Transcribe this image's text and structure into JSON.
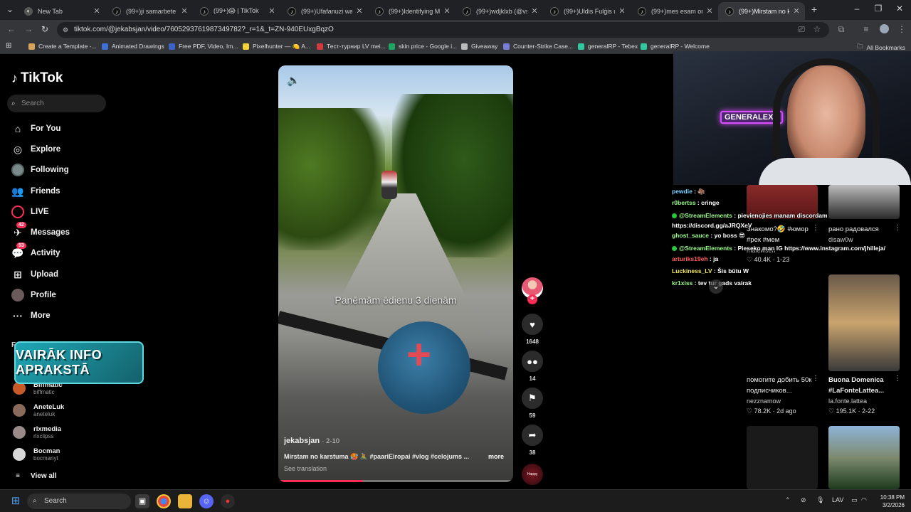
{
  "browser": {
    "tabs": [
      {
        "title": "New Tab",
        "active": false
      },
      {
        "title": "(99+)ji samarbete me",
        "active": false
      },
      {
        "title": "(99+)😱 | TikTok",
        "active": false
      },
      {
        "title": "(99+)Ufafanuzi wa Pe",
        "active": false
      },
      {
        "title": "(99+)Identifying Mys",
        "active": false
      },
      {
        "title": "(99+)wdjklxb (@vsdg",
        "active": false
      },
      {
        "title": "(99+)Uldis Fulģis un",
        "active": false
      },
      {
        "title": "(99+)mes esam origo",
        "active": false
      },
      {
        "title": "(99+)Mirstam no kars",
        "active": true
      }
    ],
    "new_tab": "+",
    "url": "tiktok.com/@jekabsjan/video/7605293761987349782?_r=1&_t=ZN-940EUxgBqzO",
    "bookmarks": [
      {
        "label": "Create a Template -...",
        "color": "#d9a35a"
      },
      {
        "label": "Animated Drawings",
        "color": "#3d6fd6"
      },
      {
        "label": "Free PDF, Video, Im...",
        "color": "#3a62c7"
      },
      {
        "label": "Pixelhunter — 🍋 A...",
        "color": "#f3d23a"
      },
      {
        "label": "Тест-турнир LV mei...",
        "color": "#d13b3b"
      },
      {
        "label": "skin price - Google i...",
        "color": "#1fa463"
      },
      {
        "label": "Giveaway",
        "color": "#bbbbbb"
      },
      {
        "label": "Counter-Strike Case...",
        "color": "#7a7fd6"
      },
      {
        "label": "generalRP - Tebex",
        "color": "#33c7a0"
      },
      {
        "label": "generalRP - Welcome",
        "color": "#33c7a0"
      }
    ],
    "all_bookmarks": "All Bookmarks"
  },
  "sidebar": {
    "logo": "TikTok",
    "search_placeholder": "Search",
    "nav": [
      {
        "label": "For You",
        "icon": "home-icon",
        "glyph": "⌂"
      },
      {
        "label": "Explore",
        "icon": "compass-icon",
        "glyph": "◎"
      },
      {
        "label": "Following",
        "icon": "following-avatar",
        "glyph": ""
      },
      {
        "label": "Friends",
        "icon": "friends-icon",
        "glyph": "👥"
      },
      {
        "label": "LIVE",
        "icon": "live-icon",
        "glyph": "◯"
      },
      {
        "label": "Messages",
        "icon": "messages-icon",
        "glyph": "✈",
        "badge": "42"
      },
      {
        "label": "Activity",
        "icon": "activity-icon",
        "glyph": "💬",
        "badge": "53"
      },
      {
        "label": "Upload",
        "icon": "upload-icon",
        "glyph": "⊞"
      },
      {
        "label": "Profile",
        "icon": "profile-avatar",
        "glyph": ""
      },
      {
        "label": "More",
        "icon": "more-icon",
        "glyph": "···"
      }
    ],
    "following_header": "F",
    "banner": "VAIRĀK INFO APRAKSTĀ",
    "following_accounts": [
      {
        "name": "Biffmatic",
        "handle": "biffmatic",
        "color": "#c85a2a"
      },
      {
        "name": "AneteLuk",
        "handle": "aneteluk",
        "color": "#8a6a5a"
      },
      {
        "name": "rlxmedia",
        "handle": "rlxclipss",
        "color": "#9a8a8a"
      },
      {
        "name": "Bocman",
        "handle": "bocmanyt",
        "color": "#d8d8d8"
      }
    ],
    "view_all": "View all"
  },
  "video": {
    "overlay_caption": "Panēmām ēdienu 3 dienām",
    "author": "jekabsjan",
    "date": "· 2-10",
    "description": "Mirstam no karstuma 🥵 🚴 #paariEiropai #vlog #celojums ...",
    "more": "more",
    "see_translation": "See translation",
    "progress": 0.36,
    "likes": "1648",
    "comments": "14",
    "saves": "59",
    "shares": "38",
    "disc_label": "Happy"
  },
  "stream": {
    "webcam_sign": "GENERALEXE",
    "chat": [
      {
        "badge": "",
        "user": "pewdie",
        "ucls": "",
        "text": " : 🦣"
      },
      {
        "badge": "",
        "user": "r0bertss",
        "ucls": "g",
        "text": " : cringe"
      },
      {
        "badge": "dot",
        "user": "@StreamElements",
        "ucls": "g",
        "text": " : pievienojies manam discordam https://discord.gg/aJRQXeV"
      },
      {
        "badge": "",
        "user": "ghost_sauce",
        "ucls": "g",
        "text": " : yo boss 😎"
      },
      {
        "badge": "dot",
        "user": "@StreamElements",
        "ucls": "g",
        "text": " : Pieseko man IG https://www.instagram.com/jhilleja/"
      },
      {
        "badge": "",
        "user": "arturiks19eh",
        "ucls": "r",
        "text": " : ja"
      },
      {
        "badge": "",
        "user": "Luckiness_LV",
        "ucls": "y",
        "text": " : Šis būtu  W"
      },
      {
        "badge": "",
        "user": "kr1xiss",
        "ucls": "g",
        "text": " : tev tur gads vairak"
      }
    ]
  },
  "grid": [
    {
      "title": "Знакомо?🤣 #юмор #рек #мем",
      "author": "malewsen",
      "likes": "40.4K",
      "date": "· 1-23"
    },
    {
      "title": "рано радовался",
      "author": "disaw0w",
      "likes": "",
      "date": ""
    },
    {
      "title": "помогите добить 50к подписчиков...",
      "author": "nezznamow",
      "likes": "78.2K",
      "date": "· 2d ago"
    },
    {
      "title": "Buona Domenica #LaFonteLattea...",
      "author": "la.fonte.lattea",
      "likes": "195.1K",
      "date": "· 2-22"
    }
  ],
  "taskbar": {
    "search": "Search",
    "lang": "LAV",
    "time": "10:38 PM",
    "date": "3/2/2026"
  }
}
